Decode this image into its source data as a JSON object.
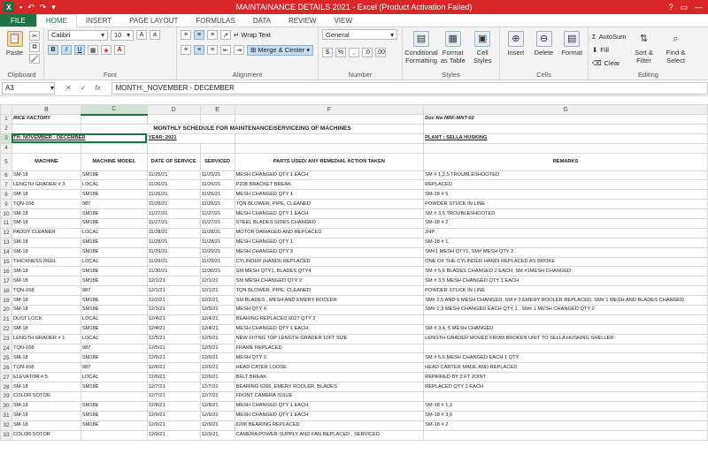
{
  "window": {
    "title": "MAINTAINANCE DETAILS 2021 -  Excel (Product Activation Failed)",
    "right_controls": [
      "?",
      "▭",
      "—"
    ]
  },
  "ribbon_tabs": [
    "FILE",
    "HOME",
    "INSERT",
    "PAGE LAYOUT",
    "FORMULAS",
    "DATA",
    "REVIEW",
    "VIEW"
  ],
  "ribbon": {
    "clipboard": {
      "paste": "Paste",
      "label": "Clipboard"
    },
    "font": {
      "name": "Calibri",
      "size": "10",
      "label": "Font"
    },
    "alignment": {
      "wrap": "Wrap Text",
      "merge": "Merge & Center",
      "label": "Alignment"
    },
    "number": {
      "format": "General",
      "label": "Number"
    },
    "styles": {
      "conditional": "Conditional Formatting",
      "table": "Format as Table",
      "cell": "Cell Styles",
      "label": "Styles"
    },
    "cells": {
      "insert": "Insert",
      "delete": "Delete",
      "format": "Format",
      "label": "Cells"
    },
    "editing": {
      "autosum": "AutoSum",
      "fill": "Fill",
      "clear": "Clear",
      "sort": "Sort & Filter",
      "find": "Find & Select",
      "label": "Editing"
    }
  },
  "formula_bar": {
    "name_box": "A3",
    "fx": "fx",
    "content": "MONTH:_NOVEMBER - DECEMBER"
  },
  "columns": [
    "B",
    "C",
    "D",
    "E",
    "F",
    "G"
  ],
  "selected_column": "C",
  "sheet": {
    "header_rows": {
      "r1_b": "RICE FACTORY",
      "r1_g": "Doc No-NRF-MNT-02",
      "r2_title": "MONTHLY SCHEDULE FOR MAINTENANCE/SERVICEING OF MACHINES",
      "r3_a": "TH:  NOVEMBER - DECEMBER",
      "r3_d": "YEAR:  2021",
      "r3_g": "PLANT : SELLA HUSKING"
    },
    "headers": [
      "MACHINE",
      "MACHINE MODEL",
      "DATE OF SERVICE",
      "SERVICED",
      "PARTS USED/ ANY REMEDIAL ACTION TAKEN",
      "REMARKS"
    ],
    "rows": [
      {
        "n": "6",
        "c": [
          "SM-18",
          "SM18E",
          "11/25/21",
          "11/25/21",
          "MESH CHANGED QTY 1 EACH",
          "SM # 1,2,5 TROUBLESHOOTED"
        ]
      },
      {
        "n": "7",
        "c": [
          "LENGTH GRADER # 3",
          "LOCAL",
          "11/26/21",
          "11/26/21",
          "P208 BRACKET BREAK",
          "REPLACED"
        ]
      },
      {
        "n": "8",
        "c": [
          "SM-18",
          "SM18E",
          "11/26/21",
          "11/26/21",
          "MESH CHANGED QTY 1",
          "SM-18 # 5"
        ]
      },
      {
        "n": "9",
        "c": [
          "TQN-168",
          "987",
          "11/26/21",
          "11/26/21",
          "TQN BLOWER, PIPE, CLEANED",
          "POWDER STUCK IN LINE"
        ]
      },
      {
        "n": "10",
        "c": [
          "SM-18",
          "SM18E",
          "11/27/21",
          "11/27/21",
          "MESH CHANGED QTY 1 EACH",
          "SM # 3,5 TROUBLESHOOTED"
        ]
      },
      {
        "n": "11",
        "c": [
          "SM-18",
          "SM18E",
          "11/27/21",
          "11/27/21",
          "STEEL BLADES SIDES CHANGED",
          "SM-18 # 2"
        ]
      },
      {
        "n": "12",
        "c": [
          "PADDY CLEANER",
          "LOCAL",
          "11/28/21",
          "11/28/21",
          "MOTOR DAMAGED AND REPLACED",
          "2HP"
        ]
      },
      {
        "n": "13",
        "c": [
          "SM-18",
          "SM18E",
          "11/28/21",
          "11/28/21",
          "MESH CHANGED QTY 1",
          "SM-18 # 1"
        ]
      },
      {
        "n": "14",
        "c": [
          "SM-18",
          "SM18E",
          "11/29/21",
          "11/29/21",
          "MESH CHANGED QTY 3",
          "SM#1 MESH QTY1,  SM# MESH QTY 2"
        ]
      },
      {
        "n": "15",
        "c": [
          "THICKNESS REEL",
          "LOCAL",
          "11/29/21",
          "11/29/21",
          "CYLINDER (HANDI) REPLACED",
          "ONE OF THE CYLINDER HANDI REPLACED AS BROKE"
        ]
      },
      {
        "n": "16",
        "c": [
          "SM-18",
          "SM18E",
          "11/30/21",
          "11/30/21",
          "SM MESH QTY1, BLADES QTY4",
          "SM # 5,6 BLADES CHANGED 2 EACH, SM #1MESH CHANGED"
        ]
      },
      {
        "n": "17",
        "c": [
          "SM-18",
          "SM18E",
          "12/1/21",
          "12/1/21",
          "SM MESH CHANGED QTY 2",
          "SM # 3,5 MESH CHANGED QTY 1 EACH"
        ]
      },
      {
        "n": "18",
        "c": [
          "TQN-168",
          "987",
          "12/1/21",
          "12/1/21",
          "TQN BLOWER, PIPE, CLEANED",
          "POWDER STUCK IN LINE"
        ]
      },
      {
        "n": "19",
        "c": [
          "SM-18",
          "SM18E",
          "12/2/21",
          "12/2/21",
          "SM BLADES , MESH AND EMERY ROOLER",
          "SM# 2,5 AND 6 MESH CHANGED, SM # 3 EMERY ROOLER REPLACED, SM# 1 MESH AND BLADES CHANGED"
        ]
      },
      {
        "n": "20",
        "c": [
          "SM-18",
          "SM18E",
          "12/3/21",
          "12/3/21",
          "MESH QTY 4",
          "SM# 2,3 MESH CHANGED EACH QTY 1 , SM# 1 MESH CHANGED QTY 2"
        ]
      },
      {
        "n": "21",
        "c": [
          "DUST LOCK",
          "LOCAL",
          "12/4/21",
          "12/4/21",
          "BEARING REPLACED 6027 QTY 2",
          ""
        ]
      },
      {
        "n": "22",
        "c": [
          "SM-18",
          "SM18E",
          "12/4/21",
          "12/4/21",
          "MESH CHANGED QTY 1 EACH",
          "SM # 3,4, 5 MESH CHANGED"
        ]
      },
      {
        "n": "23",
        "c": [
          "LENGTH GRADER # 1",
          "LOCAL",
          "12/5/21",
          "12/5/21",
          "NEW FIITNG TOP LENGTH GRADER 10FT SIZE",
          "LENGTH GRADER MOVED FROM BROKEN UNIT TO SELLA HUSKING SHELLER"
        ]
      },
      {
        "n": "24",
        "c": [
          "TQN-168",
          "987",
          "12/5/21",
          "12/5/21",
          "FRAME REPLACED",
          ""
        ]
      },
      {
        "n": "25",
        "c": [
          "SM-18",
          "SM18E",
          "12/6/21",
          "12/6/21",
          "MESH QTY 2",
          "SM # 5,6 MESH CHANGED EACH 1 QTY"
        ]
      },
      {
        "n": "26",
        "c": [
          "TQN-168",
          "987",
          "12/6/21",
          "12/6/21",
          "HEAD CATER LOOSE",
          "HEAD CARTER MADE AND REPLACED"
        ]
      },
      {
        "n": "27",
        "c": [
          "ELEVATOR # 5",
          "LOCAL",
          "12/6/21",
          "12/6/21",
          "BELT BREAK",
          "REPAIRED BY 2 FT JOINT"
        ]
      },
      {
        "n": "28",
        "c": [
          "SM-18",
          "SM18E",
          "12/7/21",
          "12/7/21",
          "BEARING 6206, EMERY ROOLER, BLADES",
          "REPLACED QTY 1 EACH"
        ]
      },
      {
        "n": "29",
        "c": [
          "COLOR SOTOR",
          "",
          "12/7/21",
          "12/7/21",
          "FRONT CAMERA ISSUE",
          ""
        ]
      },
      {
        "n": "30",
        "c": [
          "SM-18",
          "SM18E",
          "12/8/21",
          "12/8/21",
          "MESH CHANGED QTY 1 EACH",
          "SM-18 # 1,2"
        ]
      },
      {
        "n": "31",
        "c": [
          "SM-18",
          "SM18E",
          "12/9/21",
          "12/9/21",
          "MESH CHANGED QTY 1 EACH",
          "SM-18 # 3,6"
        ]
      },
      {
        "n": "32",
        "c": [
          "SM-18",
          "SM18E",
          "12/9/21",
          "12/9/21",
          "6206 BEARING REPLACED",
          "SM-18 # 2"
        ]
      },
      {
        "n": "33",
        "c": [
          "COLOR SOTOR",
          "",
          "12/9/21",
          "12/9/21",
          "CAMERA POWER SUPPLY AND FAN REPLACED , SERVICED",
          ""
        ]
      }
    ]
  }
}
